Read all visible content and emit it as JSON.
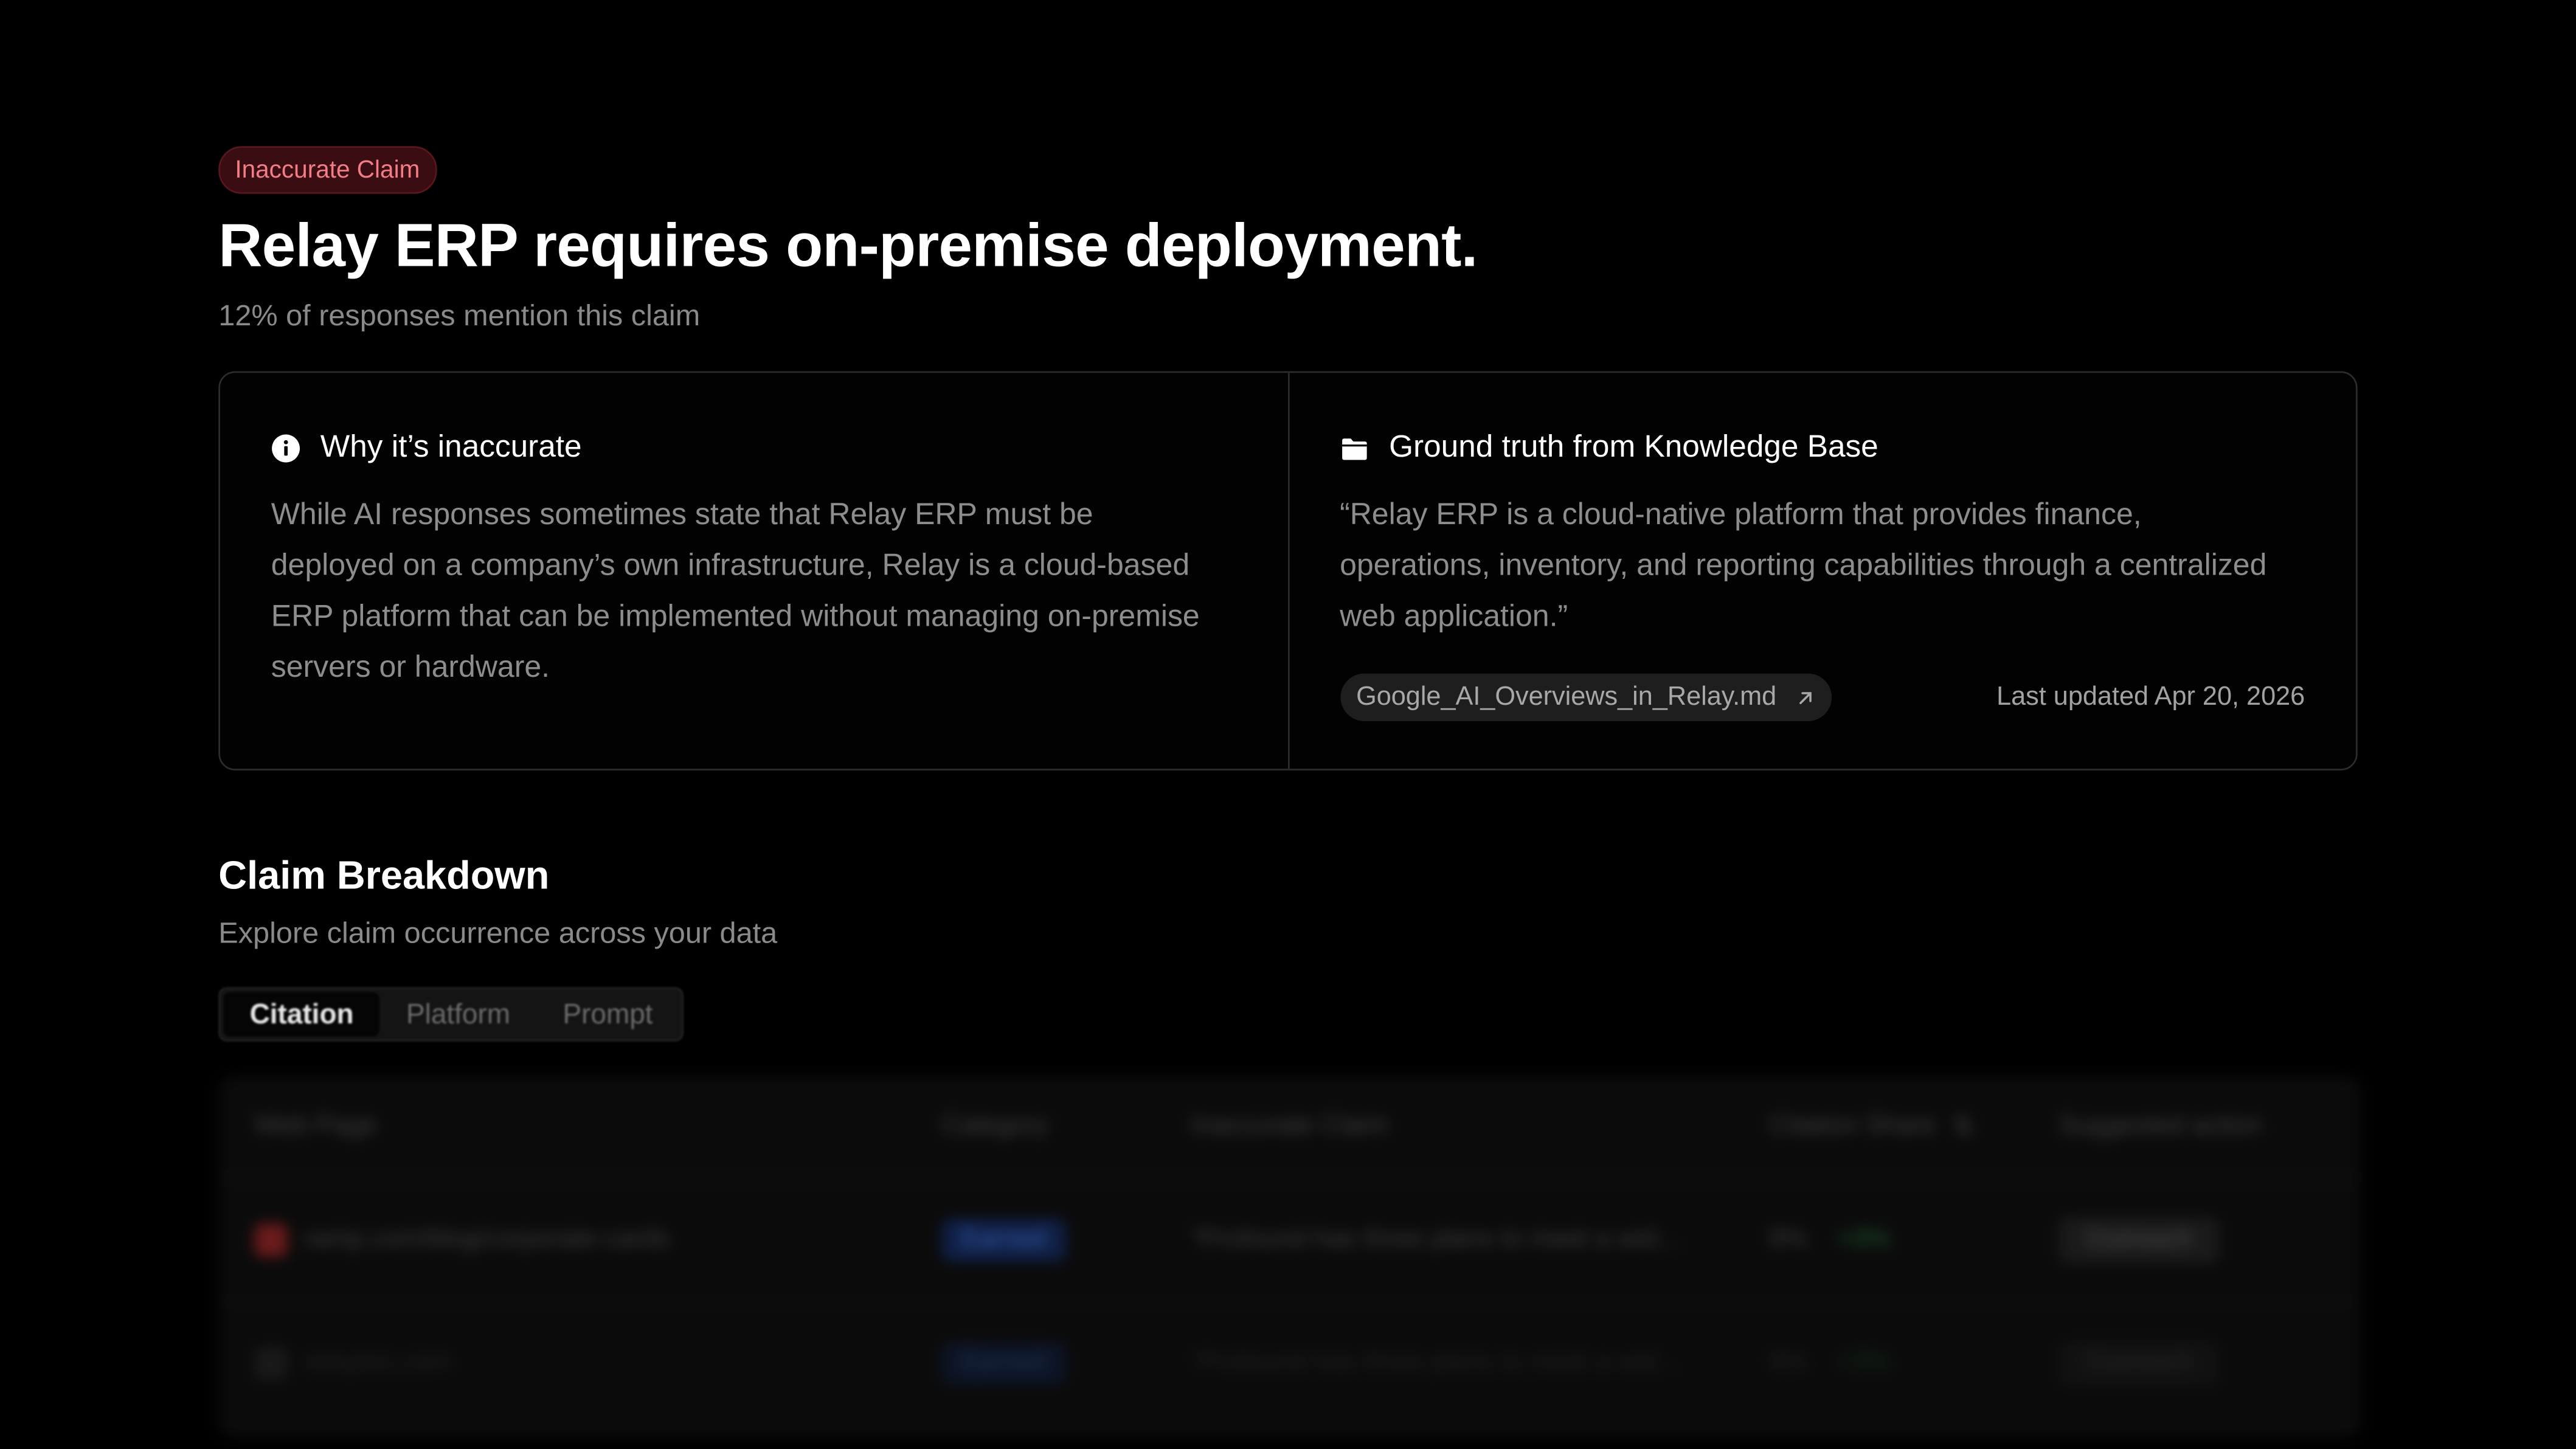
{
  "badge": {
    "label": "Inaccurate Claim"
  },
  "claim": {
    "title": "Relay ERP requires on‑premise deployment.",
    "subtitle": "12% of responses mention this claim"
  },
  "why": {
    "icon": "info-icon",
    "heading": "Why it’s inaccurate",
    "body": "While AI responses sometimes state that Relay ERP must be deployed on a company’s own infrastructure, Relay is a cloud‑based ERP platform that can be implemented without managing on‑premise servers or hardware."
  },
  "ground_truth": {
    "icon": "folder-icon",
    "heading": "Ground truth from Knowledge Base",
    "quote": "“Relay ERP is a cloud‑native platform that provides finance, operations, inventory, and reporting capabilities through a centralized web application.”",
    "file_name": "Google_AI_Overviews_in_Relay.md",
    "file_icon": "external-link-arrow-icon",
    "last_updated": "Last updated Apr 20, 2026"
  },
  "breakdown": {
    "title": "Claim Breakdown",
    "subtitle": "Explore claim occurrence across your data",
    "tabs": [
      "Citation",
      "Platform",
      "Prompt"
    ],
    "active_tab": "Citation"
  },
  "table": {
    "headers": [
      "Web Page",
      "Category",
      "Inaccurate Claim",
      "Citation Share",
      "Suggested action"
    ],
    "rows": [
      {
        "page": "ramp.com/blog/corporate-cards",
        "category": "Earned",
        "claim": "“Profound has three plans to meet a wid…",
        "share": "9%",
        "delta": "+3%",
        "action": "Outreach"
      },
      {
        "page": "relaybiz.com",
        "category": "Earned",
        "claim": "“Profound has three plans to meet a wid…",
        "share": "9%",
        "delta": "+3%",
        "action": "Outreach"
      }
    ]
  },
  "colors": {
    "background": "#000000",
    "badge_bg": "#3a0d12",
    "badge_text": "#f37d86",
    "muted_text": "#8a8a8a",
    "border": "#2c2c2c"
  }
}
